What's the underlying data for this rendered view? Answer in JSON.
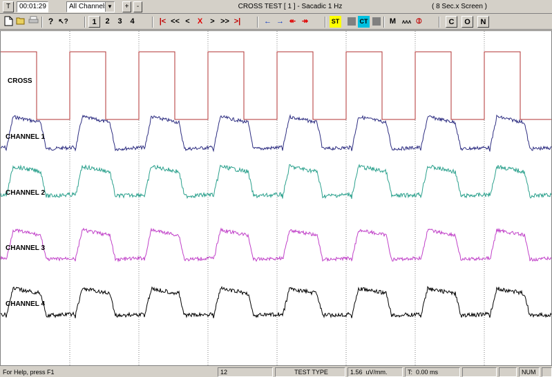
{
  "topbar": {
    "t_button": "T",
    "timer": "00:01:29",
    "channel_select": "All Channels",
    "plus": "+",
    "minus": "-",
    "title": "CROSS TEST [ 1 ] - Sacadic 1 Hz",
    "screen_info": "( 8 Sec.x Screen )"
  },
  "toolbar": {
    "ch1": "1",
    "ch2": "2",
    "ch3": "3",
    "ch4": "4",
    "nav_first": "|<",
    "nav_rew_fast": "<<",
    "nav_back": "<",
    "nav_stop": "X",
    "nav_fwd": ">",
    "nav_ff": ">>",
    "nav_last": ">|",
    "st": "ST",
    "ct": "CT",
    "m": "M",
    "c": "C",
    "o": "O",
    "n": "N"
  },
  "plot": {
    "labels": [
      "CROSS",
      "CHANNEL 1",
      "CHANNEL 2",
      "CHANNEL 3",
      "CHANNEL 4"
    ],
    "colors": {
      "cross": "#b03030",
      "ch1": "#2c2c80",
      "ch2": "#2aa08c",
      "ch3": "#c040c8",
      "ch4": "#000000",
      "grid": "#808080"
    }
  },
  "status": {
    "help": "For Help, press F1",
    "count": "12",
    "test_type": "TEST TYPE",
    "gain_value": "1.56",
    "gain_unit": "uV/mm.",
    "t_label": "T:",
    "t_value": "0.00 ms",
    "num": "NUM"
  }
}
